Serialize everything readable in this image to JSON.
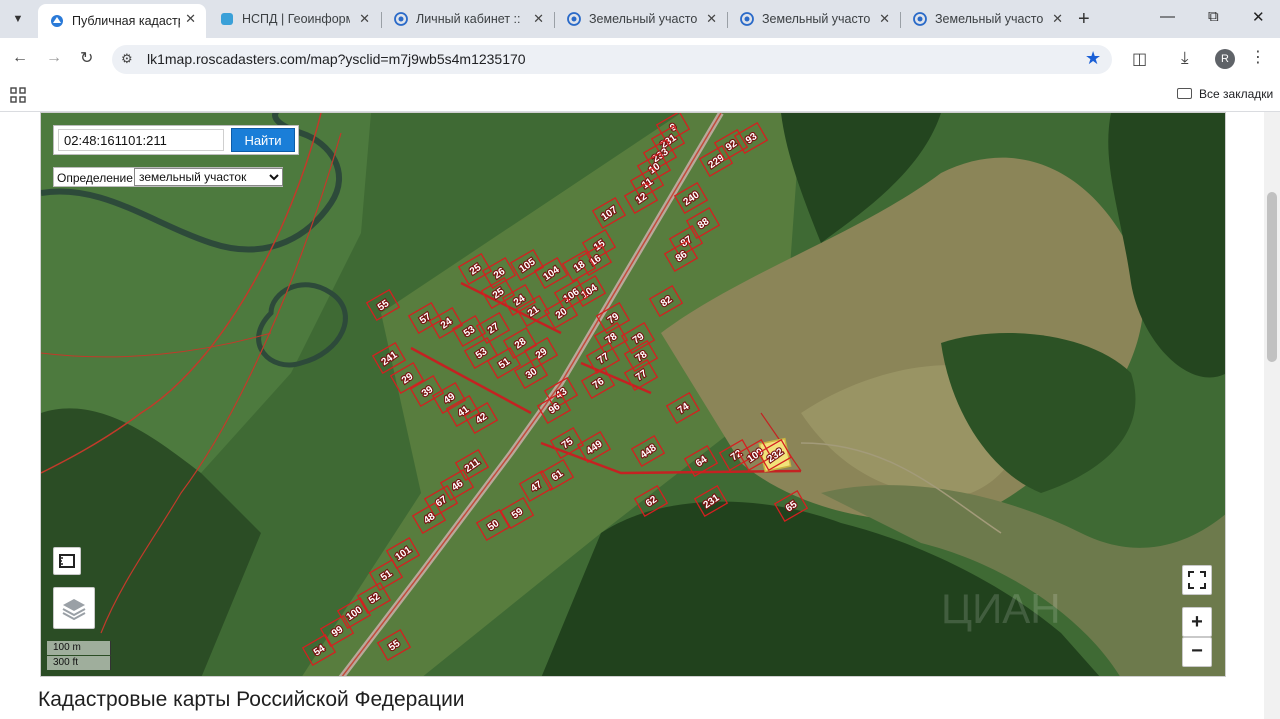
{
  "browser": {
    "tab_search_icon": "chevron-down-icon",
    "tabs": [
      {
        "label": "Публичная кадастр",
        "active": true,
        "favicon": "rosreestr-icon"
      },
      {
        "label": "НСПД | Геоинформа",
        "active": false,
        "favicon": "nspd-icon"
      },
      {
        "label": "Личный кабинет :: И",
        "active": false,
        "favicon": "globe-icon"
      },
      {
        "label": "Земельный участок",
        "active": false,
        "favicon": "globe-icon"
      },
      {
        "label": "Земельный участок",
        "active": false,
        "favicon": "globe-icon"
      },
      {
        "label": "Земельный участок",
        "active": false,
        "favicon": "globe-icon"
      }
    ],
    "new_tab_symbol": "+",
    "url": "lk1map.roscadasters.com/map?ysclid=m7j9wb5s4m1235170",
    "avatar_letter": "R",
    "bookmarks_label": "Все закладки",
    "accent_color": "#1a5fd6"
  },
  "map": {
    "search_value": "02:48:161101:211",
    "search_button": "Найти",
    "definition_label": "Определение:",
    "definition_selected": "земельный участок",
    "scale_meters": "100 m",
    "scale_feet": "300 ft",
    "zoom_in": "+",
    "zoom_out": "−",
    "highlight_color": "#f2e27a",
    "parcel_color": "#d42020",
    "parcel_labels": [
      "9",
      "231",
      "233",
      "10",
      "11",
      "12",
      "229",
      "92",
      "93",
      "240",
      "88",
      "107",
      "87",
      "86",
      "15",
      "16",
      "18",
      "104",
      "105",
      "25",
      "26",
      "25",
      "104",
      "82",
      "106",
      "24",
      "21",
      "20",
      "79",
      "79",
      "78",
      "27",
      "28",
      "29",
      "30",
      "77",
      "78",
      "77",
      "76",
      "74",
      "55",
      "57",
      "24",
      "53",
      "53",
      "51",
      "241",
      "29",
      "39",
      "49",
      "41",
      "42",
      "43",
      "96",
      "75",
      "449",
      "448",
      "64",
      "72",
      "109",
      "232",
      "211",
      "47",
      "61",
      "62",
      "231",
      "65",
      "67",
      "46",
      "48",
      "50",
      "59",
      "101",
      "51",
      "52",
      "100",
      "99",
      "54",
      "55",
      "58"
    ]
  },
  "page": {
    "heading": "Кадастровые карты Российской Федерации"
  }
}
